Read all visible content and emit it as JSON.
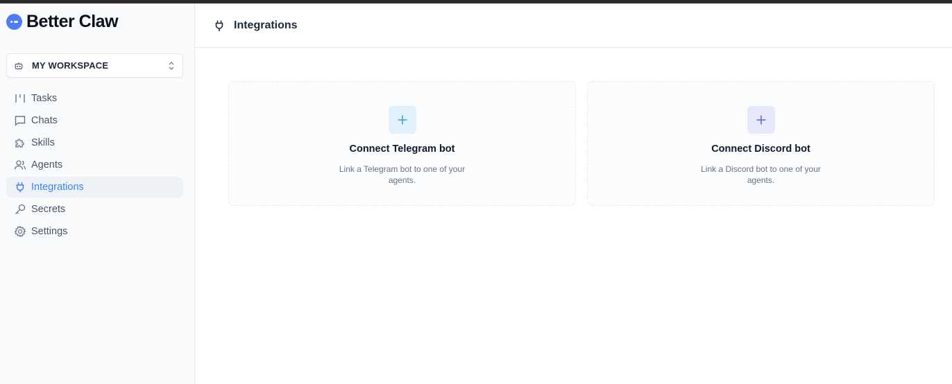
{
  "app": {
    "name": "Better Claw"
  },
  "workspace": {
    "label": "MY WORKSPACE"
  },
  "sidebar": {
    "items": [
      {
        "label": "Tasks",
        "icon": "tasks-icon",
        "active": false
      },
      {
        "label": "Chats",
        "icon": "chat-icon",
        "active": false
      },
      {
        "label": "Skills",
        "icon": "puzzle-icon",
        "active": false
      },
      {
        "label": "Agents",
        "icon": "users-icon",
        "active": false
      },
      {
        "label": "Integrations",
        "icon": "plug-icon",
        "active": true
      },
      {
        "label": "Secrets",
        "icon": "key-icon",
        "active": false
      },
      {
        "label": "Settings",
        "icon": "gear-icon",
        "active": false
      }
    ]
  },
  "header": {
    "title": "Integrations",
    "icon": "plug-icon"
  },
  "cards": [
    {
      "title": "Connect Telegram bot",
      "description": "Link a Telegram bot to one of your agents.",
      "accent": "#2f9fd8"
    },
    {
      "title": "Connect Discord bot",
      "description": "Link a Discord bot to one of your agents.",
      "accent": "#5b5ee8"
    }
  ],
  "colors": {
    "brand": "#4f7cf6",
    "active": "#3b82f6",
    "sidebar_bg": "#f8fafc"
  }
}
